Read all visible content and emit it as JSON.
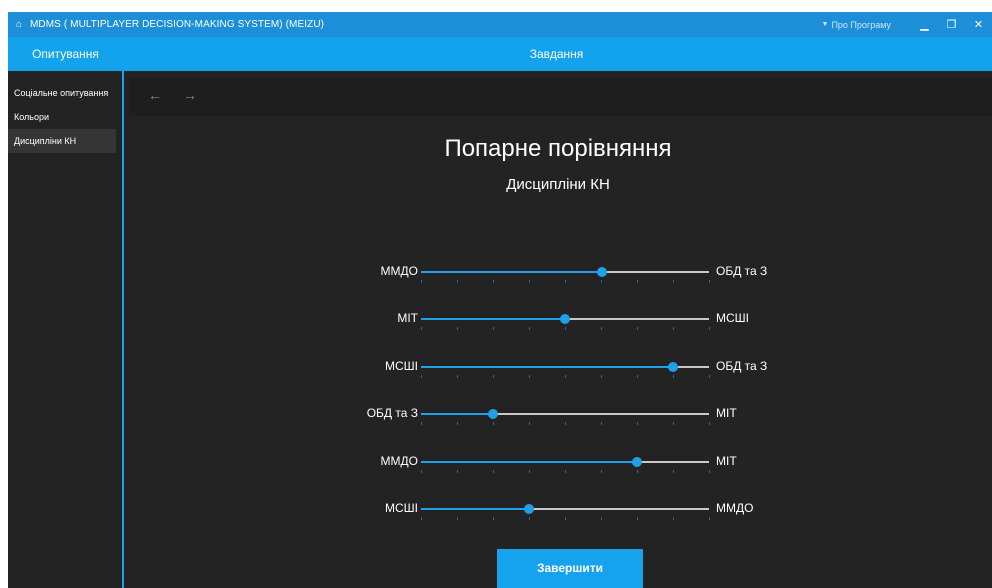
{
  "window": {
    "title": "MDMS ( MULTIPLAYER DECISION-MAKING SYSTEM)  (MEIZU)",
    "about_label": "Про Програму",
    "accent_color": "#12a3ec"
  },
  "header": {
    "left_title": "Опитування",
    "center_title": "Завдання"
  },
  "sidebar": {
    "items": [
      {
        "label": "Соціальне опитування",
        "selected": false
      },
      {
        "label": "Кольори",
        "selected": false
      },
      {
        "label": "Дисципліни КН",
        "selected": true
      }
    ]
  },
  "nav": {
    "back_icon": "←",
    "forward_icon": "→"
  },
  "main": {
    "title": "Попарне порівняння",
    "subtitle": "Дисципліни КН",
    "finish_label": "Завершити",
    "tick_count": 8,
    "comparisons": [
      {
        "left": "ММДО",
        "right": "ОБД та З",
        "value": 0.63
      },
      {
        "left": "МІТ",
        "right": "МСШІ",
        "value": 0.5
      },
      {
        "left": "МСШІ",
        "right": "ОБД та З",
        "value": 0.875
      },
      {
        "left": "ОБД та З",
        "right": "МІТ",
        "value": 0.25
      },
      {
        "left": "ММДО",
        "right": "МІТ",
        "value": 0.75
      },
      {
        "left": "МСШІ",
        "right": "ММДО",
        "value": 0.375
      }
    ]
  }
}
